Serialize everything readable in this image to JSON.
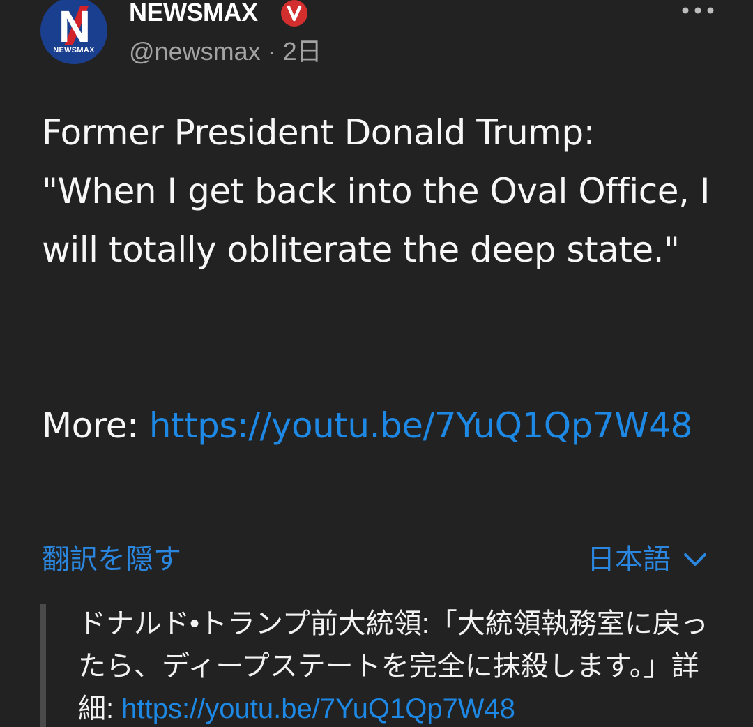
{
  "account": {
    "avatar_text": "NEWSMAX",
    "display_name": "NEWSMAX",
    "handle": "@newsmax",
    "separator": "·",
    "timestamp": "2日",
    "verified_badge_color": "#d32f2f"
  },
  "post": {
    "text": "Former President Donald Trump:\n\"When I get back into the Oval Office, I will totally obliterate the deep state.\"",
    "more_label": "More: ",
    "link": "https://youtu.be/7YuQ1Qp7W48"
  },
  "translation": {
    "hide_label": "翻訳を隠す",
    "language_label": "日本語",
    "text": "ドナルド•トランプ前大統領:「大統領執務室に戻ったら、ディープステートを完全に抹殺します。」詳細: ",
    "link": "https://youtu.be/7YuQ1Qp7W48"
  },
  "colors": {
    "background": "#222222",
    "link": "#1e88e5",
    "accent": "#2a86de"
  }
}
